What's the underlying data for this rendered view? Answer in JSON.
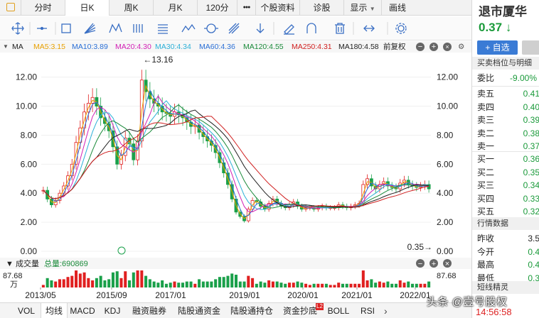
{
  "topbar": {
    "tabs": [
      {
        "label": "分时",
        "w": 62
      },
      {
        "label": "日K",
        "w": 62
      },
      {
        "label": "周K",
        "w": 62
      },
      {
        "label": "月K",
        "w": 62
      },
      {
        "label": "120分",
        "w": 56
      },
      {
        "label": "●●●",
        "w": 26
      },
      {
        "label": "个股资料",
        "w": 62
      },
      {
        "label": "诊股",
        "w": 62
      }
    ],
    "display_menu": "显示",
    "draw_line": "画线"
  },
  "ma_legend": {
    "label": "MA",
    "items": [
      {
        "text": "MA5:3.15",
        "color": "#e8a000"
      },
      {
        "text": "MA10:3.89",
        "color": "#2a6fd6"
      },
      {
        "text": "MA20:4.30",
        "color": "#d21fb5"
      },
      {
        "text": "MA30:4.34",
        "color": "#2bb0d8"
      },
      {
        "text": "MA60:4.36",
        "color": "#2a6fd6"
      },
      {
        "text": "MA120:4.55",
        "color": "#1a8a3a"
      },
      {
        "text": "MA250:4.31",
        "color": "#d02020"
      },
      {
        "text": "MA180:4.58",
        "color": "#222222"
      }
    ],
    "restore": "前复权"
  },
  "chart_data": {
    "type": "candlestick",
    "price_axis": [
      12.0,
      10.0,
      8.0,
      6.0,
      4.0,
      2.0,
      0.0
    ],
    "ylim": [
      0,
      13.5
    ],
    "max_annotation": "←13.16",
    "min_annotation": "0.35→",
    "x_ticks": [
      "2013/05",
      "2015/09",
      "2017/01",
      "2019/01",
      "2020/01",
      "2021/01",
      "2022/01"
    ],
    "volume_label": "成交量",
    "volume_total": "总量:690869",
    "volume_axis": "87.68",
    "volume_unit": "万",
    "close_series": [
      4.2,
      3.6,
      3.2,
      3.5,
      4.0,
      4.5,
      5.2,
      6.0,
      7.5,
      8.5,
      9.6,
      10.2,
      10.6,
      10.0,
      9.2,
      8.8,
      8.3,
      7.2,
      6.0,
      6.6,
      7.8,
      7.4,
      6.3,
      7.6,
      11.8,
      11.0,
      10.5,
      10.2,
      10.0,
      9.6,
      9.5,
      9.3,
      9.6,
      9.4,
      9.2,
      8.9,
      8.6,
      8.7,
      8.2,
      7.9,
      7.6,
      7.3,
      6.8,
      6.1,
      5.4,
      4.6,
      3.6,
      2.7,
      2.4,
      2.1,
      2.9,
      3.5,
      3.4,
      3.1,
      2.9,
      3.3,
      3.6,
      3.3,
      3.1,
      3.0,
      3.2,
      3.4,
      3.1,
      2.9,
      3.0,
      3.0,
      2.9,
      3.0,
      3.1,
      3.0,
      3.0,
      3.0,
      3.2,
      3.1,
      3.0,
      3.1,
      3.2,
      3.3,
      4.6,
      5.0,
      4.5,
      4.3,
      4.6,
      4.8,
      4.5,
      4.4,
      4.3,
      4.7,
      4.9,
      4.6,
      4.5,
      4.4,
      4.5,
      4.6,
      4.3
    ]
  },
  "bottom_tabs": [
    "VOL",
    "均线",
    "MACD",
    "KDJ",
    "融资融券",
    "陆股通资金",
    "陆股通持仓",
    "资金抄底",
    "BOLL",
    "RSI"
  ],
  "bottom_badge": "L2",
  "right_panel": {
    "name": "退市厦华",
    "price": "0.37",
    "arrow": "↓",
    "add_label": "+ 自选",
    "orderbook_title": "买卖档位与明细",
    "webi_label": "委比",
    "webi_value": "-9.00%",
    "sells": [
      {
        "k": "卖五",
        "v": "0.41"
      },
      {
        "k": "卖四",
        "v": "0.40"
      },
      {
        "k": "卖三",
        "v": "0.39"
      },
      {
        "k": "卖二",
        "v": "0.38"
      },
      {
        "k": "卖一",
        "v": "0.37"
      }
    ],
    "buys": [
      {
        "k": "买一",
        "v": "0.36"
      },
      {
        "k": "买二",
        "v": "0.35"
      },
      {
        "k": "买三",
        "v": "0.34"
      },
      {
        "k": "买四",
        "v": "0.33"
      },
      {
        "k": "买五",
        "v": "0.32"
      }
    ],
    "quote_title": "行情数据",
    "quotes": [
      {
        "k": "昨收",
        "v": "3.5"
      },
      {
        "k": "今开",
        "v": "0.4"
      },
      {
        "k": "最高",
        "v": "0.4"
      },
      {
        "k": "最低",
        "v": "0.3"
      }
    ],
    "short_title": "短线精灵",
    "time": "14:56:58"
  },
  "watermark": "头条 @壹号股权"
}
